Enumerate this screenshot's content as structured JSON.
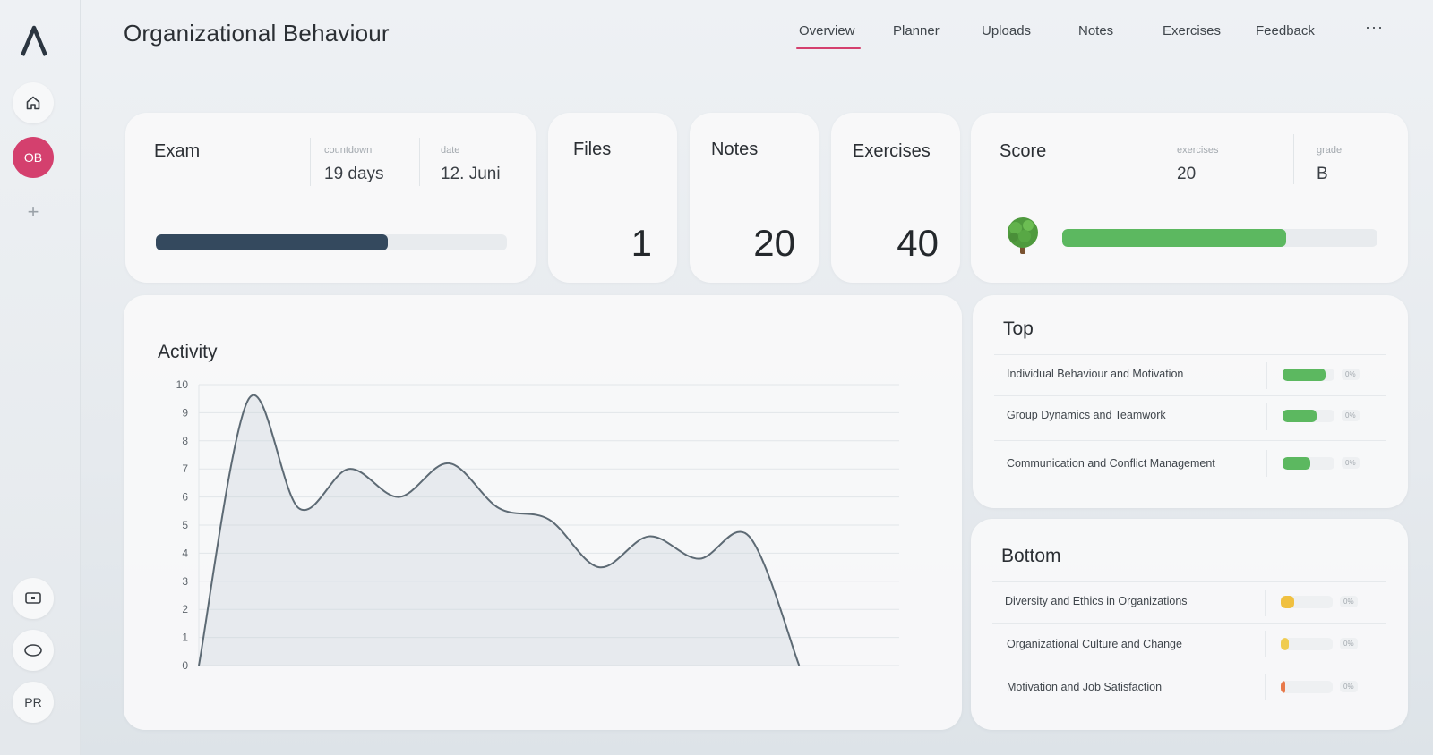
{
  "sidebar": {
    "logo": "Λ",
    "items": [
      {
        "name": "home-icon"
      },
      {
        "label": "OB",
        "active": true
      },
      {
        "label": "+"
      },
      {
        "name": "screen-icon"
      },
      {
        "name": "oval-icon"
      },
      {
        "label": "PR"
      }
    ]
  },
  "header": {
    "title": "Organizational Behaviour",
    "tabs": [
      "Overview",
      "Planner",
      "Uploads",
      "Notes",
      "Exercises",
      "Feedback"
    ],
    "active_tab": "Overview",
    "more": "···"
  },
  "exam": {
    "title": "Exam",
    "countdown_label": "countdown",
    "countdown_value": "19 days",
    "date_label": "date",
    "date_value": "12. Juni",
    "progress": 0.66,
    "color": "#34495e"
  },
  "files": {
    "title": "Files",
    "value": "1"
  },
  "notes": {
    "title": "Notes",
    "value": "20"
  },
  "exercises": {
    "title": "Exercises",
    "value": "40"
  },
  "score": {
    "title": "Score",
    "exercises_label": "exercises",
    "exercises_value": "20",
    "grade_label": "grade",
    "grade_value": "B",
    "progress": 0.71,
    "color": "#5cb860",
    "icon": "tree-icon"
  },
  "activity": {
    "title": "Activity"
  },
  "chart_data": {
    "type": "area",
    "title": "Activity",
    "xlabel": "",
    "ylabel": "",
    "ylim": [
      0,
      10
    ],
    "yticks": [
      0,
      1,
      2,
      3,
      4,
      5,
      6,
      7,
      8,
      9,
      10
    ],
    "grid": true,
    "x": [
      0,
      1,
      2,
      3,
      4,
      5,
      6,
      7,
      8,
      9,
      10,
      11,
      12,
      13,
      14
    ],
    "values": [
      0,
      9.5,
      5.6,
      7.0,
      6.0,
      7.2,
      5.6,
      5.2,
      3.5,
      4.6,
      3.8,
      4.6,
      0,
      null,
      null
    ]
  },
  "top": {
    "title": "Top",
    "items": [
      {
        "label": "Individual Behaviour and Motivation",
        "fill": 0.82,
        "color": "#5cb860",
        "pct": "0%"
      },
      {
        "label": "Group Dynamics and Teamwork",
        "fill": 0.66,
        "color": "#5cb860",
        "pct": "0%"
      },
      {
        "label": "Communication and Conflict Management",
        "fill": 0.54,
        "color": "#5cb860",
        "pct": "0%"
      }
    ]
  },
  "bottom": {
    "title": "Bottom",
    "items": [
      {
        "label": "Diversity and Ethics in Organizations",
        "fill": 0.26,
        "color": "#f0c040",
        "pct": "0%"
      },
      {
        "label": "Organizational Culture and Change",
        "fill": 0.16,
        "color": "#f0cc50",
        "pct": "0%"
      },
      {
        "label": "Motivation and Job Satisfaction",
        "fill": 0.08,
        "color": "#e8794a",
        "pct": "0%"
      }
    ]
  }
}
